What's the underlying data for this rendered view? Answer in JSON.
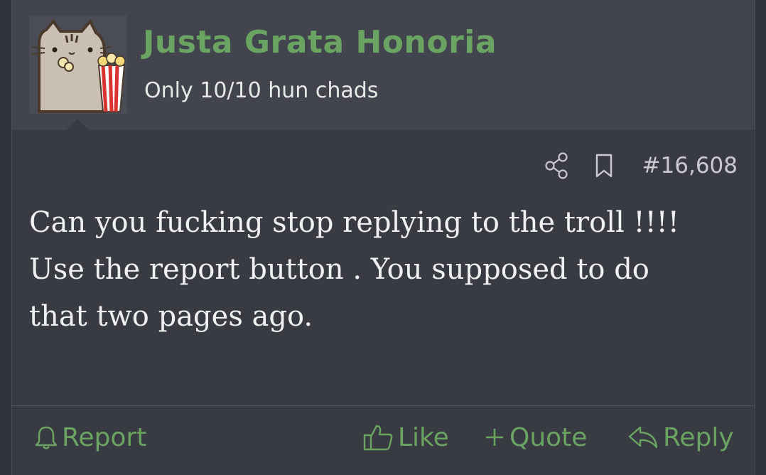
{
  "user": {
    "name": "Justa Grata Honoria",
    "title": "Only 10/10 hun chads",
    "avatar_icon": "pusheen-popcorn-avatar"
  },
  "post": {
    "number": "#16,608",
    "body": "Can you fucking stop replying to the troll !!!!\nUse the report button . You supposed to do\nthat two pages ago."
  },
  "actions": {
    "report_label": "Report",
    "like_label": "Like",
    "quote_label": "Quote",
    "reply_label": "Reply"
  },
  "colors": {
    "accent": "#6aa362",
    "background": "#383b42",
    "header": "#42454d",
    "text": "#f0f0f0"
  }
}
